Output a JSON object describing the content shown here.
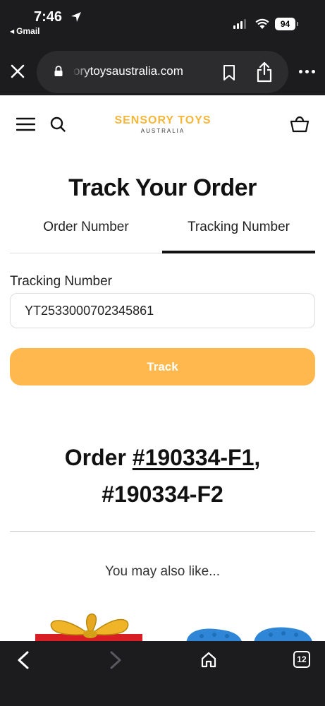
{
  "status_bar": {
    "time": "7:46",
    "back_app": "Gmail",
    "battery": "94"
  },
  "browser": {
    "url": "orytoysaustralia.com",
    "tab_count": "12"
  },
  "site": {
    "logo_main": "SENSORY TOYS",
    "logo_sub": "AUSTRALIA",
    "brand_color": "#f5b63a"
  },
  "main": {
    "title": "Track Your Order",
    "tabs": [
      {
        "label": "Order Number",
        "active": false
      },
      {
        "label": "Tracking Number",
        "active": true
      }
    ],
    "field_label": "Tracking Number",
    "tracking_value": "YT2533000702345861",
    "track_button": "Track",
    "track_button_color": "#ffb84d",
    "order_prefix": "Order ",
    "order_1": "#190334-F1",
    "order_sep": ",",
    "order_2": "#190334-F2",
    "also_like": "You may also like..."
  },
  "icons": {
    "status": [
      "location-arrow-icon",
      "signal-icon",
      "wifi-icon",
      "battery-icon"
    ],
    "browser": [
      "close-icon",
      "lock-icon",
      "bookmark-icon",
      "share-icon",
      "more-icon"
    ],
    "header": [
      "menu-icon",
      "search-icon",
      "cart-icon"
    ],
    "toolbar": [
      "nav-back-icon",
      "nav-forward-icon",
      "home-icon",
      "tabs-icon"
    ]
  }
}
